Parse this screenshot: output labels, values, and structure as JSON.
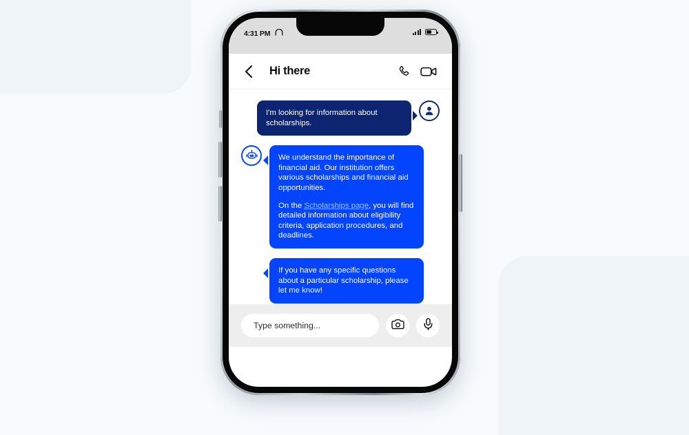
{
  "background": {
    "page_color": "#f7fbfd",
    "shape_color": "#eef4f8"
  },
  "phone": {
    "status_bar": {
      "time": "4:31 PM",
      "headphones_icon": "headphones-icon",
      "signal_icon": "signal-bars-icon",
      "battery_icon": "battery-icon"
    },
    "header": {
      "back_icon": "chevron-left-icon",
      "title": "Hi there",
      "call_icon": "phone-icon",
      "video_icon": "video-camera-icon"
    },
    "messages": [
      {
        "sender": "user",
        "avatar": "person-avatar-icon",
        "bubble_color": "#0d2470",
        "paragraphs": [
          "I'm looking for information about scholarships."
        ]
      },
      {
        "sender": "bot",
        "avatar": "robot-avatar-icon",
        "bubble_color": "#0345ff",
        "paragraphs": [
          "We understand the importance of financial aid. Our institution offers various scholarships and financial aid opportunities.",
          ""
        ],
        "link_paragraph": {
          "prefix": "On the ",
          "link_text": "Scholarships page",
          "link_color": "#9ac4ff",
          "suffix": ", you will find detailed information about eligibility criteria, application procedures, and deadlines."
        }
      },
      {
        "sender": "bot",
        "bubble_color": "#0345ff",
        "paragraphs": [
          "If you have any specific questions about a particular scholarship, please let me know!"
        ]
      }
    ],
    "footer": {
      "input_placeholder": "Type something...",
      "input_value": "",
      "camera_icon": "camera-icon",
      "mic_icon": "microphone-icon"
    },
    "side_buttons": {
      "silence": "silence-switch",
      "volume_up": "volume-up-button",
      "volume_down": "volume-down-button",
      "power": "power-button"
    }
  }
}
